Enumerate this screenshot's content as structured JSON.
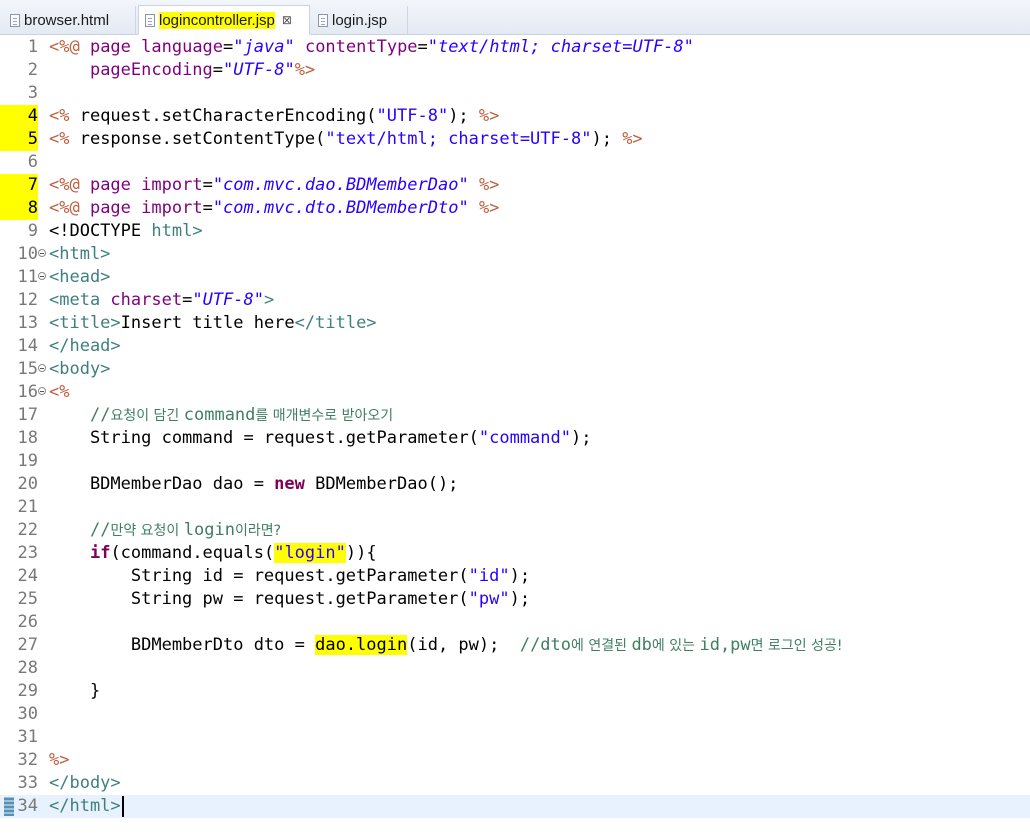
{
  "tabs": [
    {
      "label": "browser.html",
      "active": false
    },
    {
      "label": "logincontroller.jsp",
      "active": true
    },
    {
      "label": "login.jsp",
      "active": false
    }
  ],
  "editor": {
    "lines": [
      {
        "n": "1",
        "tokens": [
          [
            "jsp",
            "<%@ "
          ],
          [
            "kw2",
            "page "
          ],
          [
            "attr",
            "language"
          ],
          [
            "plain",
            "="
          ],
          [
            "istr",
            "\"java\""
          ],
          [
            "plain",
            " "
          ],
          [
            "attr",
            "contentType"
          ],
          [
            "plain",
            "="
          ],
          [
            "istr",
            "\"text/html; charset=UTF-8\""
          ]
        ]
      },
      {
        "n": "2",
        "tokens": [
          [
            "plain",
            "    "
          ],
          [
            "attr",
            "pageEncoding"
          ],
          [
            "plain",
            "="
          ],
          [
            "istr",
            "\"UTF-8\""
          ],
          [
            "jsp",
            "%>"
          ]
        ]
      },
      {
        "n": "3",
        "tokens": []
      },
      {
        "n": "4",
        "mark": true,
        "tokens": [
          [
            "jsp",
            "<% "
          ],
          [
            "plain",
            "request.setCharacterEncoding("
          ],
          [
            "str",
            "\"UTF-8\""
          ],
          [
            "plain",
            "); "
          ],
          [
            "jsp",
            "%>"
          ]
        ]
      },
      {
        "n": "5",
        "mark": true,
        "tokens": [
          [
            "jsp",
            "<% "
          ],
          [
            "plain",
            "response.setContentType("
          ],
          [
            "str",
            "\"text/html; charset=UTF-8\""
          ],
          [
            "plain",
            "); "
          ],
          [
            "jsp",
            "%>"
          ]
        ]
      },
      {
        "n": "6",
        "tokens": []
      },
      {
        "n": "7",
        "mark": true,
        "tokens": [
          [
            "jsp",
            "<%@ "
          ],
          [
            "kw2",
            "page "
          ],
          [
            "attr",
            "import"
          ],
          [
            "plain",
            "="
          ],
          [
            "istr",
            "\"com.mvc.dao.BDMemberDao\""
          ],
          [
            "plain",
            " "
          ],
          [
            "jsp",
            "%>"
          ]
        ]
      },
      {
        "n": "8",
        "mark": true,
        "tokens": [
          [
            "jsp",
            "<%@ "
          ],
          [
            "kw2",
            "page "
          ],
          [
            "attr",
            "import"
          ],
          [
            "plain",
            "="
          ],
          [
            "istr",
            "\"com.mvc.dto.BDMemberDto\""
          ],
          [
            "plain",
            " "
          ],
          [
            "jsp",
            "%>"
          ]
        ]
      },
      {
        "n": "9",
        "tokens": [
          [
            "plain",
            "<!DOCTYPE "
          ],
          [
            "tag",
            "html"
          ],
          [
            "tag",
            ">"
          ]
        ]
      },
      {
        "n": "10",
        "fold": true,
        "tokens": [
          [
            "tag",
            "<html>"
          ]
        ]
      },
      {
        "n": "11",
        "fold": true,
        "tokens": [
          [
            "tag",
            "<head>"
          ]
        ]
      },
      {
        "n": "12",
        "tokens": [
          [
            "tag",
            "<meta "
          ],
          [
            "attr",
            "charset"
          ],
          [
            "plain",
            "="
          ],
          [
            "istr",
            "\"UTF-8\""
          ],
          [
            "tag",
            ">"
          ]
        ]
      },
      {
        "n": "13",
        "tokens": [
          [
            "tag",
            "<title>"
          ],
          [
            "plain",
            "Insert title here"
          ],
          [
            "tag",
            "</title>"
          ]
        ]
      },
      {
        "n": "14",
        "tokens": [
          [
            "tag",
            "</head>"
          ]
        ]
      },
      {
        "n": "15",
        "fold": true,
        "tokens": [
          [
            "tag",
            "<body>"
          ]
        ]
      },
      {
        "n": "16",
        "fold": true,
        "tokens": [
          [
            "jsp",
            "<%"
          ]
        ]
      },
      {
        "n": "17",
        "tokens": [
          [
            "plain",
            "    "
          ],
          [
            "cmt",
            "//"
          ],
          [
            "cmtkr",
            "요청이 담긴 "
          ],
          [
            "cmt",
            "command"
          ],
          [
            "cmtkr",
            "를 매개변수로 받아오기"
          ]
        ]
      },
      {
        "n": "18",
        "tokens": [
          [
            "plain",
            "    String command = request.getParameter("
          ],
          [
            "str",
            "\"command\""
          ],
          [
            "plain",
            ");"
          ]
        ]
      },
      {
        "n": "19",
        "tokens": []
      },
      {
        "n": "20",
        "tokens": [
          [
            "plain",
            "    BDMemberDao dao = "
          ],
          [
            "kw",
            "new"
          ],
          [
            "plain",
            " BDMemberDao();"
          ]
        ]
      },
      {
        "n": "21",
        "tokens": []
      },
      {
        "n": "22",
        "tokens": [
          [
            "plain",
            "    "
          ],
          [
            "cmt",
            "//"
          ],
          [
            "cmtkr",
            "만약 요청이 "
          ],
          [
            "cmt",
            "login"
          ],
          [
            "cmtkr",
            "이라면?"
          ]
        ]
      },
      {
        "n": "23",
        "tokens": [
          [
            "plain",
            "    "
          ],
          [
            "kw",
            "if"
          ],
          [
            "plain",
            "(command.equals("
          ],
          [
            "strhl",
            "\"login\""
          ],
          [
            "plain",
            "))"
          ],
          [
            "plain",
            "{"
          ]
        ]
      },
      {
        "n": "24",
        "tokens": [
          [
            "plain",
            "        String id = request.getParameter("
          ],
          [
            "str",
            "\"id\""
          ],
          [
            "plain",
            ");"
          ]
        ]
      },
      {
        "n": "25",
        "tokens": [
          [
            "plain",
            "        String pw = request.getParameter("
          ],
          [
            "str",
            "\"pw\""
          ],
          [
            "plain",
            ");"
          ]
        ]
      },
      {
        "n": "26",
        "tokens": []
      },
      {
        "n": "27",
        "tokens": [
          [
            "plain",
            "        BDMemberDto dto = "
          ],
          [
            "plainhl",
            "dao.login"
          ],
          [
            "plain",
            "(id, pw);  "
          ],
          [
            "cmt",
            "//dto"
          ],
          [
            "cmtkr",
            "에 연결된 "
          ],
          [
            "cmt",
            "db"
          ],
          [
            "cmtkr",
            "에 있는 "
          ],
          [
            "cmt",
            "id,pw"
          ],
          [
            "cmtkr",
            "면 로그인 성공!"
          ]
        ]
      },
      {
        "n": "28",
        "tokens": []
      },
      {
        "n": "29",
        "tokens": [
          [
            "plain",
            "    }"
          ]
        ]
      },
      {
        "n": "30",
        "tokens": []
      },
      {
        "n": "31",
        "tokens": []
      },
      {
        "n": "32",
        "tokens": [
          [
            "jsp",
            "%>"
          ]
        ]
      },
      {
        "n": "33",
        "tokens": [
          [
            "tag",
            "</body>"
          ]
        ]
      },
      {
        "n": "34",
        "current": true,
        "bookmark": true,
        "tokens": [
          [
            "tag",
            "</html>"
          ]
        ]
      }
    ]
  },
  "colors": {
    "keyword": "#7f0055",
    "string": "#2a00ff",
    "tag": "#3f7f7f",
    "attribute": "#7f007f",
    "jsp_delimiter": "#bf5f3f",
    "comment": "#3f7f5f",
    "highlight": "#ffff00",
    "current_line": "#e8f2fe"
  }
}
